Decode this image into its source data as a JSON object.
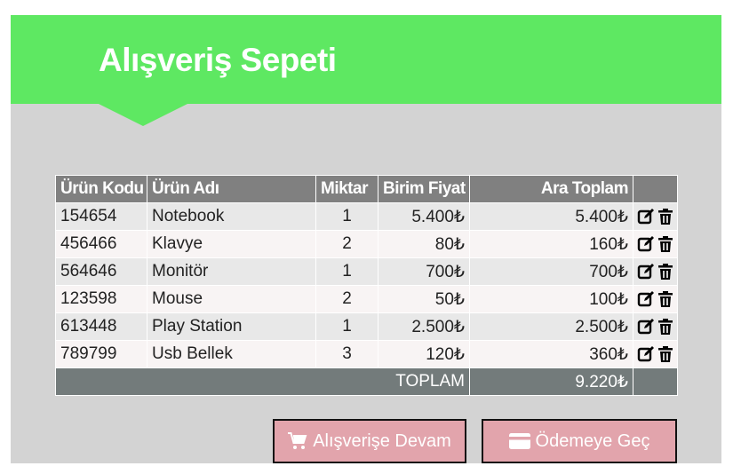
{
  "header": {
    "title": "Alışveriş Sepeti"
  },
  "table": {
    "columns": [
      "Ürün Kodu",
      "Ürün Adı",
      "Miktar",
      "Birim Fiyat",
      "Ara Toplam",
      ""
    ],
    "rows": [
      {
        "code": "154654",
        "name": "Notebook",
        "qty": "1",
        "unit_price": "5.400₺",
        "subtotal": "5.400₺"
      },
      {
        "code": "456466",
        "name": "Klavye",
        "qty": "2",
        "unit_price": "80₺",
        "subtotal": "160₺"
      },
      {
        "code": "564646",
        "name": "Monitör",
        "qty": "1",
        "unit_price": "700₺",
        "subtotal": "700₺"
      },
      {
        "code": "123598",
        "name": "Mouse",
        "qty": "2",
        "unit_price": "50₺",
        "subtotal": "100₺"
      },
      {
        "code": "613448",
        "name": "Play Station",
        "qty": "1",
        "unit_price": "2.500₺",
        "subtotal": "2.500₺"
      },
      {
        "code": "789799",
        "name": "Usb Bellek",
        "qty": "3",
        "unit_price": "120₺",
        "subtotal": "360₺"
      }
    ],
    "row_icons": [
      "edit-icon",
      "trash-icon"
    ],
    "footer": {
      "label": "TOPLAM",
      "total": "9.220₺"
    }
  },
  "buttons": {
    "continue": {
      "label": "Alışverişe Devam",
      "icon": "cart-icon"
    },
    "checkout": {
      "label": "Ödemeye Geç",
      "icon": "credit-card-icon"
    }
  },
  "colors": {
    "header_bg": "#5ee862",
    "panel_bg": "#d3d3d3",
    "table_header_bg": "#808080",
    "table_footer_bg": "#737b7b",
    "button_bg": "#e2a4ac"
  }
}
